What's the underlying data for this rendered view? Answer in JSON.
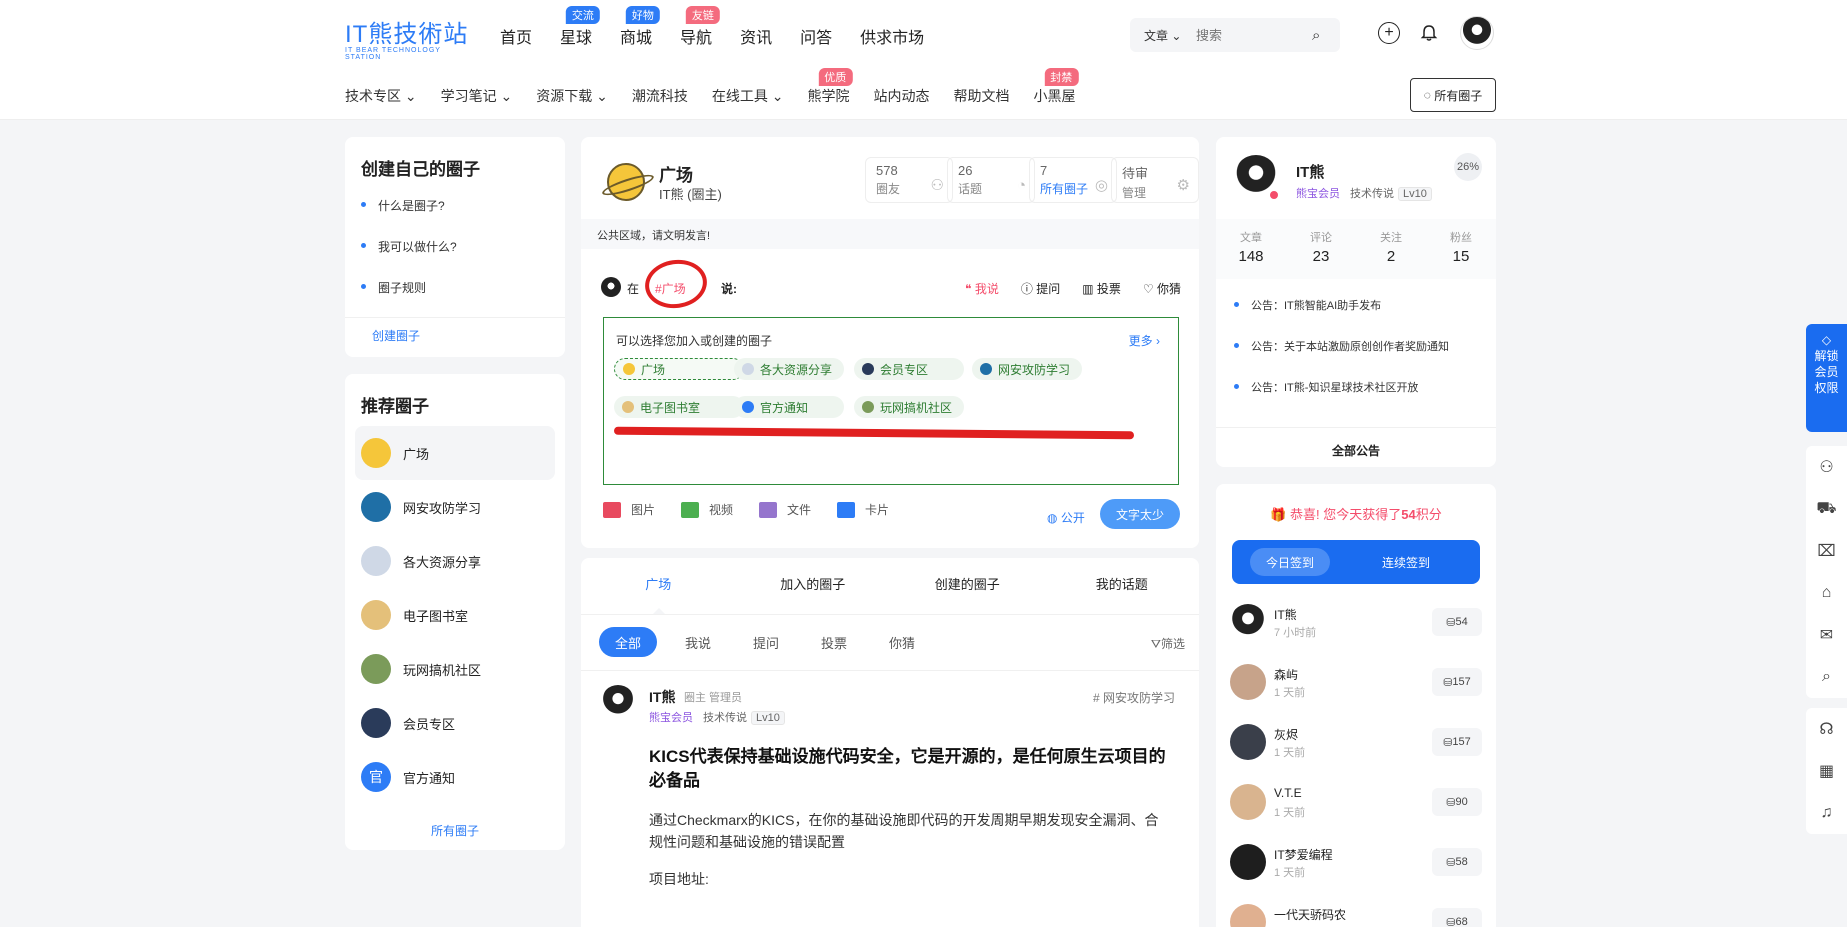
{
  "header": {
    "logo_main": "IT熊技術站",
    "logo_sub": "IT BEAR TECHNOLOGY STATION",
    "nav": [
      {
        "label": "首页",
        "badge": ""
      },
      {
        "label": "星球",
        "badge": "交流",
        "badge_color": "#2d7cf6"
      },
      {
        "label": "商城",
        "badge": "好物",
        "badge_color": "#2d7cf6"
      },
      {
        "label": "导航",
        "badge": "友链",
        "badge_color": "#f46b7e"
      },
      {
        "label": "资讯",
        "badge": ""
      },
      {
        "label": "问答",
        "badge": ""
      },
      {
        "label": "供求市场",
        "badge": ""
      }
    ],
    "search": {
      "category": "文章",
      "placeholder": "搜索"
    },
    "subnav": [
      {
        "label": "技术专区",
        "badge": "",
        "dropdown": true
      },
      {
        "label": "学习笔记",
        "badge": "",
        "dropdown": true
      },
      {
        "label": "资源下载",
        "badge": "",
        "dropdown": true
      },
      {
        "label": "潮流科技",
        "badge": "",
        "dropdown": false
      },
      {
        "label": "在线工具",
        "badge": "",
        "dropdown": true
      },
      {
        "label": "熊学院",
        "badge": "优质",
        "dropdown": false
      },
      {
        "label": "站内动态",
        "badge": "",
        "dropdown": false
      },
      {
        "label": "帮助文档",
        "badge": "",
        "dropdown": false
      },
      {
        "label": "小黑屋",
        "badge": "封禁",
        "dropdown": false
      }
    ],
    "all_circles_btn": "所有圈子"
  },
  "left_create": {
    "title": "创建自己的圈子",
    "items": [
      "什么是圈子?",
      "我可以做什么?",
      "圈子规则"
    ],
    "create_link": "创建圈子"
  },
  "left_recommend": {
    "title": "推荐圈子",
    "items": [
      {
        "label": "广场",
        "color": "#f5c63a",
        "icon": "planet-icon"
      },
      {
        "label": "网安攻防学习",
        "color": "#1f6fa6",
        "icon": "security-icon"
      },
      {
        "label": "各大资源分享",
        "color": "#cfd8e6",
        "icon": "folder-icon"
      },
      {
        "label": "电子图书室",
        "color": "#e4c07a",
        "icon": "books-icon"
      },
      {
        "label": "玩网搞机社区",
        "color": "#7b9b5a",
        "icon": "tool-icon"
      },
      {
        "label": "会员专区",
        "color": "#2a3b5a",
        "icon": "vip-icon"
      },
      {
        "label": "官方通知",
        "color": "#2d7cf6",
        "icon": "official-icon"
      }
    ],
    "all_link": "所有圈子"
  },
  "circle": {
    "title": "广场",
    "owner": "IT熊 (圈主)",
    "stats": [
      {
        "num": "578",
        "label": "圈友",
        "blue": false
      },
      {
        "num": "26",
        "label": "话题",
        "blue": false
      },
      {
        "num": "7",
        "label": "所有圈子",
        "blue": true
      },
      {
        "num": "待审",
        "label": "管理",
        "blue": false
      }
    ],
    "notice": "公共区域，请文明发言!"
  },
  "composer": {
    "prefix": "在",
    "tag": "#广场",
    "suffix": "说:",
    "options": [
      "我说",
      "提问",
      "投票",
      "你猜"
    ],
    "select_header": "可以选择您加入或创建的圈子",
    "more": "更多 ›",
    "chips": [
      {
        "label": "广场",
        "color": "#f5c63a"
      },
      {
        "label": "各大资源分享",
        "color": "#cfd8e6"
      },
      {
        "label": "会员专区",
        "color": "#2a3b5a"
      },
      {
        "label": "网安攻防学习",
        "color": "#1f6fa6"
      },
      {
        "label": "电子图书室",
        "color": "#e4c07a"
      },
      {
        "label": "官方通知",
        "color": "#2d7cf6"
      },
      {
        "label": "玩网搞机社区",
        "color": "#7b9b5a"
      }
    ],
    "tools": [
      {
        "label": "图片",
        "color": "#e84a5f"
      },
      {
        "label": "视频",
        "color": "#4caf50"
      },
      {
        "label": "文件",
        "color": "#9575cd"
      },
      {
        "label": "卡片",
        "color": "#2d7cf6"
      }
    ],
    "visibility": "公开",
    "submit": "文字太少"
  },
  "feed": {
    "tabs": [
      "广场",
      "加入的圈子",
      "创建的圈子",
      "我的话题"
    ],
    "filters": [
      "全部",
      "我说",
      "提问",
      "投票",
      "你猜"
    ],
    "filter_btn": "筛选",
    "post": {
      "author": "IT熊",
      "roles": "圈主 管理员",
      "vip": "熊宝会员",
      "level_title": "技术传说",
      "level": "Lv10",
      "tag": "# 网安攻防学习",
      "title": "KICS代表保持基础设施代码安全，它是开源的，是任何原生云项目的必备品",
      "body": "通过Checkmarx的KICS，在你的基础设施即代码的开发周期早期发现安全漏洞、合规性问题和基础设施的错误配置",
      "addr": "项目地址:"
    }
  },
  "profile": {
    "name": "IT熊",
    "vip": "熊宝会员",
    "level_title": "技术传说",
    "level": "Lv10",
    "progress": "26%",
    "stats": [
      {
        "label": "文章",
        "num": "148"
      },
      {
        "label": "评论",
        "num": "23"
      },
      {
        "label": "关注",
        "num": "2"
      },
      {
        "label": "粉丝",
        "num": "15"
      }
    ],
    "announcements": [
      "公告：IT熊智能AI助手发布",
      "公告：关于本站激励原创创作者奖励通知",
      "公告：IT熊-知识星球技术社区开放"
    ],
    "all_announcements": "全部公告"
  },
  "checkin": {
    "congrats_prefix": "恭喜! 您今天获得了",
    "congrats_points": "54",
    "congrats_suffix": "积分",
    "today": "今日签到",
    "continuous": "连续签到",
    "ranking": [
      {
        "name": "IT熊",
        "time": "7 小时前",
        "points": "54",
        "color": "#222"
      },
      {
        "name": "森屿",
        "time": "1 天前",
        "points": "157",
        "color": "#c7a38a"
      },
      {
        "name": "灰烬",
        "time": "1 天前",
        "points": "157",
        "color": "#3a3f4a"
      },
      {
        "name": "V.T.E",
        "time": "1 天前",
        "points": "90",
        "color": "#d9b48f"
      },
      {
        "name": "IT梦爱编程",
        "time": "1 天前",
        "points": "58",
        "color": "#1e1e1e"
      },
      {
        "name": "一代天骄码农",
        "time": "",
        "points": "68",
        "color": "#e0b090"
      }
    ]
  },
  "float": {
    "unlock": [
      "解锁",
      "会员",
      "权限"
    ]
  }
}
